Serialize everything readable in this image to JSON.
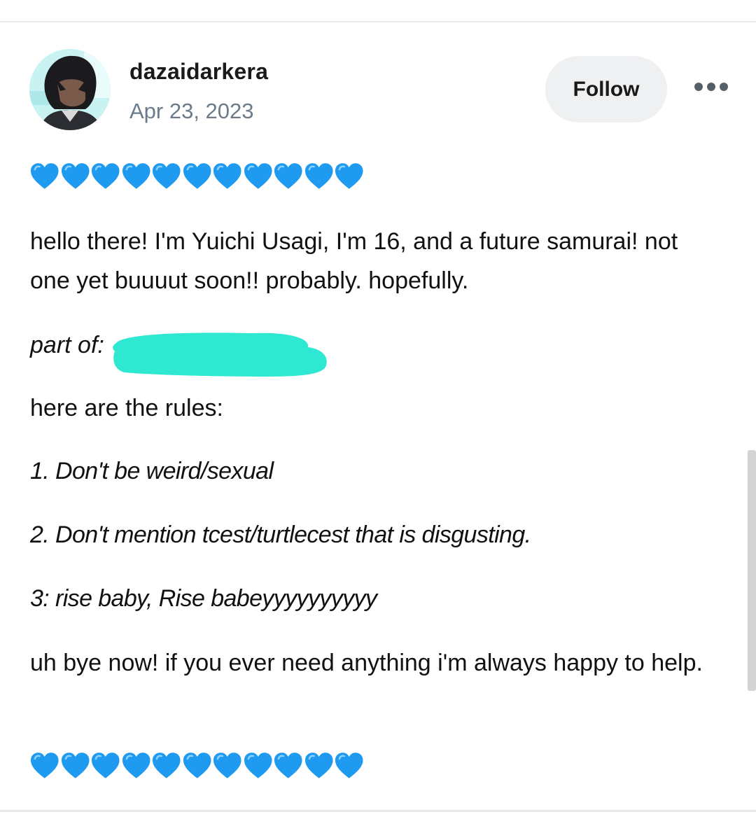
{
  "post": {
    "username": "dazaidarkera",
    "date": "Apr 23, 2023",
    "follow_label": "Follow",
    "more_icon": "ellipsis-icon",
    "hearts_emoji": "💙",
    "hearts_count": 11,
    "hearts_color": "#1e9bf0",
    "body": {
      "intro": "hello there! I'm Yuichi Usagi, I'm 16, and a future samurai! not one yet buuuut soon!! probably. hopefully.",
      "part_of": "part of:",
      "rules_intro": "here are the rules:",
      "rules": [
        "1. Don't be weird/sexual",
        "2. Don't mention tcest/turtlecest that is disgusting.",
        "3: rise baby, Rise babeyyyyyyyyyy"
      ],
      "outro": "uh bye now! if you ever need anything i'm always happy to help."
    },
    "redaction_color": "#2ee8d2"
  }
}
